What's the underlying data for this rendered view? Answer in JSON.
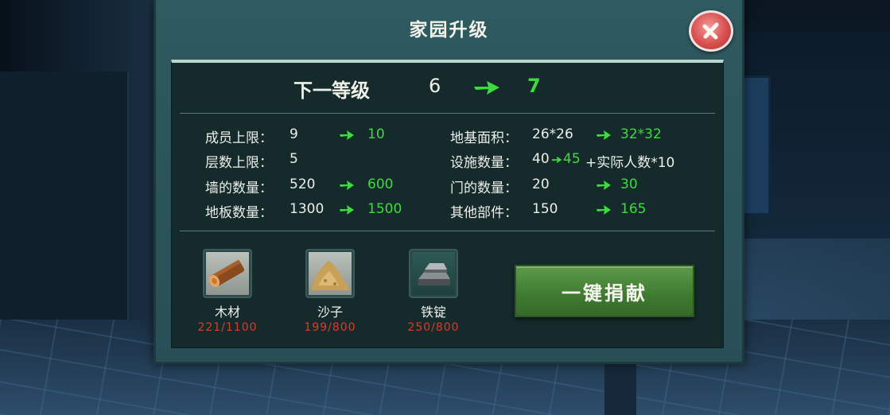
{
  "dialog": {
    "title": "家园升级"
  },
  "level": {
    "label": "下一等级",
    "current": "6",
    "next": "7"
  },
  "stats_left": [
    {
      "label": "成员上限：",
      "current": "9",
      "next": "10"
    },
    {
      "label": "层数上限：",
      "current": "5",
      "next": ""
    },
    {
      "label": "墙的数量：",
      "current": "520",
      "next": "600"
    },
    {
      "label": "地板数量：",
      "current": "1300",
      "next": "1500"
    }
  ],
  "stats_right": [
    {
      "label": "地基面积：",
      "current": "26*26",
      "next": "32*32"
    },
    {
      "label": "设施数量：",
      "current": "40",
      "next": "45",
      "suffix": "+实际人数*10"
    },
    {
      "label": "门的数量：",
      "current": "20",
      "next": "30"
    },
    {
      "label": "其他部件：",
      "current": "150",
      "next": "165"
    }
  ],
  "resources": [
    {
      "name": "木材",
      "count": "221/1100",
      "icon": "wood-log-icon"
    },
    {
      "name": "沙子",
      "count": "199/800",
      "icon": "sand-pile-icon"
    },
    {
      "name": "铁锭",
      "count": "250/800",
      "icon": "iron-ingot-icon"
    }
  ],
  "donate_button": "一键捐献",
  "colors": {
    "accent_green": "#3ddc3d",
    "shortage_red": "#e03a2a",
    "panel": "#284f55",
    "inner_panel": "#142a2b",
    "button_green": "#4a8a3a"
  }
}
